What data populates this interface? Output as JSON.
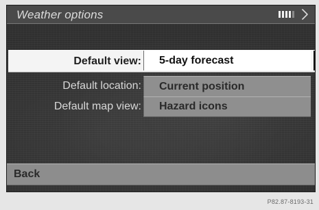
{
  "header": {
    "title": "Weather options"
  },
  "options": [
    {
      "label": "Default view:",
      "value": "5-day forecast"
    },
    {
      "label": "Default location:",
      "value": "Current position"
    },
    {
      "label": "Default map view:",
      "value": "Hazard icons"
    }
  ],
  "footer": {
    "back_label": "Back",
    "code": "P82.87-8193-31"
  }
}
